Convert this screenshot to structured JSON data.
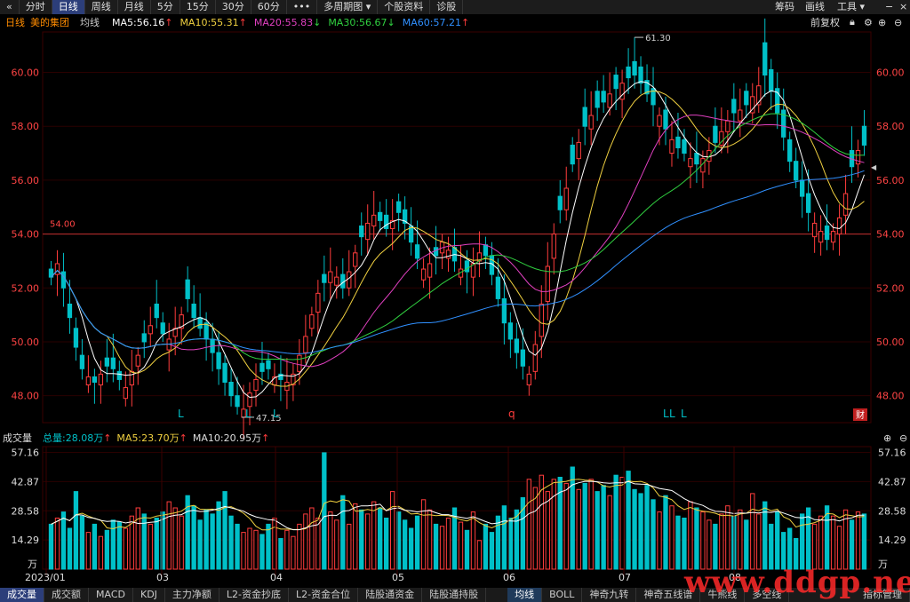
{
  "toolbar": {
    "back_icon": "«",
    "tabs": [
      "分时",
      "日线",
      "周线",
      "月线",
      "5分",
      "15分",
      "30分",
      "60分",
      "•••",
      "多周期图 ▾",
      "个股资料",
      "诊股"
    ],
    "active_tab": "日线",
    "right": [
      "筹码",
      "画线",
      "工具 ▾"
    ],
    "window_controls": [
      "−",
      "×"
    ]
  },
  "header": {
    "period": "日线",
    "stock_name": "美的集团",
    "ma_label": "均线",
    "ma": [
      {
        "text": "MA5:56.16",
        "arrow": "↑",
        "color": "#ffffff"
      },
      {
        "text": "MA10:55.31",
        "arrow": "↑",
        "color": "#f0d040"
      },
      {
        "text": "MA20:55.83",
        "arrow": "↓",
        "color": "#e040c0"
      },
      {
        "text": "MA30:56.67",
        "arrow": "↓",
        "color": "#30d040"
      },
      {
        "text": "MA60:57.21",
        "arrow": "↑",
        "color": "#3090ff"
      }
    ],
    "adjust": "前复权",
    "icons": [
      "lock-icon",
      "gear-icon",
      "plus-icon",
      "minus-icon"
    ]
  },
  "price_axis": {
    "ticks": [
      "60.00",
      "58.00",
      "56.00",
      "54.00",
      "52.00",
      "50.00",
      "48.00"
    ],
    "high_label": "61.30",
    "low_label": "47.15",
    "ref_label": "54.00",
    "marker_labels": [
      "L",
      "L",
      "L",
      "q",
      "L",
      "L",
      "L"
    ],
    "fin_label": "财"
  },
  "volume": {
    "title": "成交量",
    "total": "总量:28.08万",
    "total_arrow": "↑",
    "ma5": "MA5:23.70万",
    "ma5_arrow": "↑",
    "ma10": "MA10:20.95万",
    "ma10_arrow": "↑",
    "ticks": [
      "57.16",
      "42.87",
      "28.58",
      "14.29",
      "万"
    ]
  },
  "date_axis": {
    "labels": [
      "2023/01",
      "03",
      "04",
      "05",
      "06",
      "07",
      "08"
    ]
  },
  "bottom_tabs": {
    "left": [
      "成交量",
      "成交额",
      "MACD",
      "KDJ",
      "主力净额",
      "L2-资金抄底",
      "L2-资金合位",
      "陆股通资金",
      "陆股通持股"
    ],
    "right": [
      "均线",
      "BOLL",
      "神奇九转",
      "神奇五线谱",
      "牛熊线",
      "多空线"
    ],
    "far_right": "指标管理",
    "active_left": "成交量",
    "active_right": "均线"
  },
  "watermark": "www.ddgp.net",
  "colors": {
    "up": "#ff3c3c",
    "down": "#00c0c8",
    "grid": "#2a0000",
    "axis_text": "#ff4444"
  },
  "chart_data": {
    "type": "candlestick",
    "y_range": [
      47,
      61.5
    ],
    "closes": [
      52.4,
      52.9,
      52.0,
      50.9,
      49.8,
      49.0,
      48.7,
      48.5,
      48.8,
      49.1,
      49.0,
      48.6,
      48.3,
      48.9,
      49.5,
      50.0,
      50.6,
      50.9,
      50.3,
      50.1,
      50.5,
      51.0,
      51.6,
      50.9,
      50.5,
      50.1,
      49.6,
      49.0,
      48.5,
      48.0,
      47.6,
      47.5,
      48.1,
      48.6,
      48.9,
      49.0,
      48.7,
      48.6,
      48.5,
      48.8,
      49.5,
      50.2,
      51.0,
      51.8,
      52.2,
      52.6,
      52.4,
      52.0,
      52.6,
      53.3,
      53.9,
      54.4,
      54.7,
      54.5,
      54.2,
      54.5,
      54.8,
      54.4,
      53.7,
      53.1,
      52.7,
      52.9,
      53.2,
      53.7,
      53.4,
      53.0,
      52.7,
      52.6,
      52.9,
      53.3,
      53.2,
      52.5,
      51.6,
      50.7,
      50.1,
      49.6,
      49.1,
      48.8,
      49.9,
      51.4,
      52.8,
      54.0,
      54.9,
      55.7,
      56.6,
      57.4,
      58.0,
      58.4,
      58.7,
      58.9,
      59.2,
      59.4,
      59.6,
      59.8,
      59.9,
      59.6,
      59.2,
      58.8,
      58.4,
      57.9,
      57.5,
      57.2,
      57.0,
      56.8,
      56.6,
      56.8,
      57.1,
      57.4,
      57.8,
      58.2,
      58.5,
      58.6,
      58.8,
      59.1,
      59.5,
      59.9,
      59.3,
      58.5,
      57.6,
      56.7,
      56.0,
      55.4,
      54.8,
      54.4,
      54.1,
      53.8,
      54.1,
      54.6,
      55.5,
      56.5,
      57.1,
      57.3
    ],
    "opens_delta": [
      0.3,
      -0.4,
      0.6,
      0.5,
      0.7,
      0.5,
      -0.3,
      0.2,
      -0.4,
      0.3,
      0.4,
      0.3,
      -0.4,
      -0.5,
      -0.4,
      0.3,
      -0.3,
      0.5,
      0.4,
      -0.4,
      -0.3,
      -0.5,
      0.7,
      0.5,
      0.4,
      0.6,
      0.5,
      0.6,
      0.7,
      0.5,
      0.4,
      -0.3,
      -0.5,
      -0.4,
      0.3,
      0.3,
      -0.3,
      0.2,
      -0.3,
      -0.4,
      -0.6,
      -0.6,
      -0.5,
      -0.7,
      0.3,
      -0.4,
      -0.3,
      0.5,
      -0.6,
      -0.5,
      0.4,
      -0.6,
      -0.4,
      0.3,
      0.5,
      -0.3,
      0.4,
      0.5,
      0.6,
      0.5,
      -0.4,
      -0.5,
      0.3,
      -0.4,
      -0.3,
      0.5,
      -0.3,
      0.4,
      -0.5,
      -0.3,
      0.4,
      0.7,
      0.8,
      0.9,
      0.6,
      0.5,
      0.6,
      -0.4,
      -1.0,
      -1.2,
      -1.3,
      -0.9,
      0.5,
      -0.8,
      0.7,
      -0.6,
      0.7,
      -0.5,
      0.6,
      0.4,
      -0.5,
      0.5,
      -0.6,
      0.4,
      0.5,
      0.6,
      0.5,
      0.6,
      -0.4,
      0.7,
      -0.5,
      0.4,
      0.5,
      -0.3,
      0.4,
      -0.5,
      -0.4,
      0.6,
      -0.5,
      -0.4,
      0.5,
      -0.4,
      0.5,
      -0.6,
      -0.7,
      1.2,
      0.8,
      0.9,
      1.0,
      0.8,
      0.7,
      0.6,
      0.7,
      -0.5,
      -0.4,
      0.5,
      -0.4,
      -0.6,
      -0.8,
      0.6,
      -0.5,
      0.7
    ],
    "volumes": [
      22,
      25,
      28,
      20,
      38,
      26,
      18,
      22,
      16,
      19,
      24,
      23,
      20,
      26,
      30,
      27,
      22,
      25,
      28,
      33,
      30,
      26,
      36,
      31,
      24,
      29,
      27,
      33,
      38,
      26,
      22,
      18,
      20,
      19,
      17,
      22,
      25,
      15,
      19,
      16,
      22,
      27,
      30,
      25,
      57,
      28,
      24,
      36,
      22,
      32,
      29,
      27,
      33,
      30,
      25,
      38,
      28,
      24,
      20,
      26,
      34,
      29,
      22,
      21,
      25,
      30,
      23,
      19,
      28,
      14,
      22,
      18,
      26,
      31,
      25,
      29,
      35,
      44,
      40,
      46,
      38,
      44,
      45,
      42,
      50,
      39,
      42,
      44,
      38,
      41,
      36,
      46,
      45,
      48,
      39,
      37,
      41,
      34,
      28,
      36,
      31,
      26,
      25,
      33,
      30,
      28,
      24,
      22,
      27,
      31,
      26,
      29,
      24,
      37,
      27,
      33,
      22,
      28,
      18,
      20,
      15,
      27,
      30,
      22,
      26,
      31,
      26,
      21,
      29,
      24,
      28,
      27
    ]
  }
}
